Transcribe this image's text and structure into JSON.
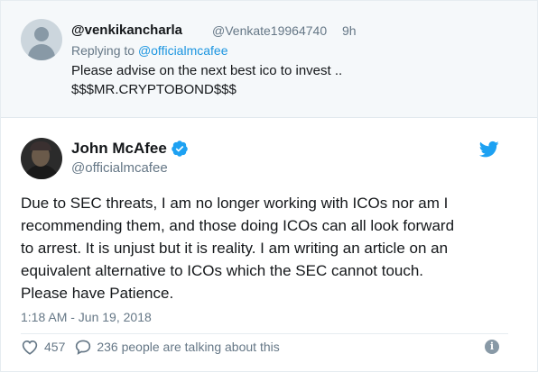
{
  "reply_tweet": {
    "display_name": "@venkikancharla",
    "handle": "@Venkate19964740",
    "time": "9h",
    "replying_prefix": "Replying to ",
    "replying_to": "@officialmcafee",
    "text_line1": "Please advise on the next best ico to invest ..",
    "text_line2": "$$$MR.CRYPTOBOND$$$",
    "avatar": "default-avatar-icon"
  },
  "main_tweet": {
    "display_name": "John McAfee",
    "handle": "@officialmcafee",
    "verified": true,
    "text_lines": [
      "Due to SEC threats, I am no longer working with ICOs nor am I",
      "recommending them, and those doing ICOs can all look forward",
      "to arrest. It is unjust but it is reality. I am writing an article on an",
      "equivalent alternative to ICOs which the SEC cannot touch.",
      "Please have Patience."
    ],
    "timestamp": "1:18 AM - Jun 19, 2018",
    "likes": "457",
    "replies_text": "236 people are talking about this"
  },
  "colors": {
    "twitter_blue": "#1da1f2",
    "link_blue": "#1b95e0",
    "secondary_text": "#657786",
    "reply_bg": "#f5f8fa"
  },
  "icons": {
    "verified": "verified-badge-icon",
    "brand": "twitter-bird-icon",
    "like": "heart-icon",
    "reply": "speech-bubble-icon",
    "info": "info-icon"
  }
}
